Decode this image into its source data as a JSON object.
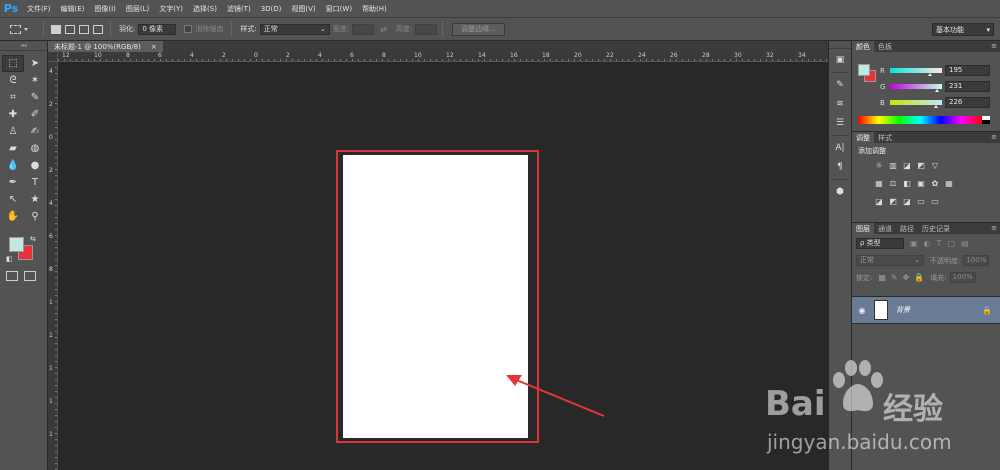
{
  "app": {
    "logo": "Ps"
  },
  "menu": [
    "文件(F)",
    "编辑(E)",
    "图像(I)",
    "图层(L)",
    "文字(Y)",
    "选择(S)",
    "滤镜(T)",
    "3D(D)",
    "视图(V)",
    "窗口(W)",
    "帮助(H)"
  ],
  "options": {
    "feather_label": "羽化:",
    "feather_value": "0 像素",
    "antialias_label": "消除锯齿",
    "style_label": "样式:",
    "style_value": "正常",
    "width_label": "宽度:",
    "height_label": "高度:",
    "refine_button": "调整边缘...",
    "workspace": "基本功能"
  },
  "document": {
    "tab_title": "未标题-1 @ 100%(RGB/8)",
    "tab_close": "×",
    "ruler_h": [
      "12",
      "10",
      "8",
      "6",
      "4",
      "2",
      "0",
      "2",
      "4",
      "6",
      "8",
      "10",
      "12",
      "14",
      "16",
      "18",
      "20",
      "22",
      "24",
      "26",
      "28",
      "30",
      "32",
      "34"
    ],
    "ruler_v": [
      "4",
      "2",
      "0",
      "2",
      "4",
      "6",
      "8",
      "1",
      "1",
      "1",
      "1",
      "1"
    ]
  },
  "panels": {
    "color_tabs": [
      "颜色",
      "色板"
    ],
    "rgb": [
      {
        "label": "R",
        "value": "195"
      },
      {
        "label": "G",
        "value": "231"
      },
      {
        "label": "B",
        "value": "226"
      }
    ],
    "adjust_tabs": [
      "调整",
      "样式"
    ],
    "adjust_title": "添加调整",
    "layer_tabs": [
      "图层",
      "通道",
      "路径",
      "历史记录"
    ],
    "filter_kind": "ρ 类型",
    "blend_mode": "正常",
    "opacity_label": "不透明度:",
    "opacity_value": "100%",
    "lock_label": "锁定:",
    "fill_label": "填充:",
    "fill_value": "100%",
    "layer_name": "背景"
  },
  "watermark": {
    "brand_left": "Bai",
    "brand_right": "经验",
    "url": "jingyan.baidu.com"
  },
  "colors": {
    "foreground": "#c3e7e2",
    "background": "#e8323a",
    "highlight": "#d9343a",
    "layer_selected": "#6a7b96"
  }
}
